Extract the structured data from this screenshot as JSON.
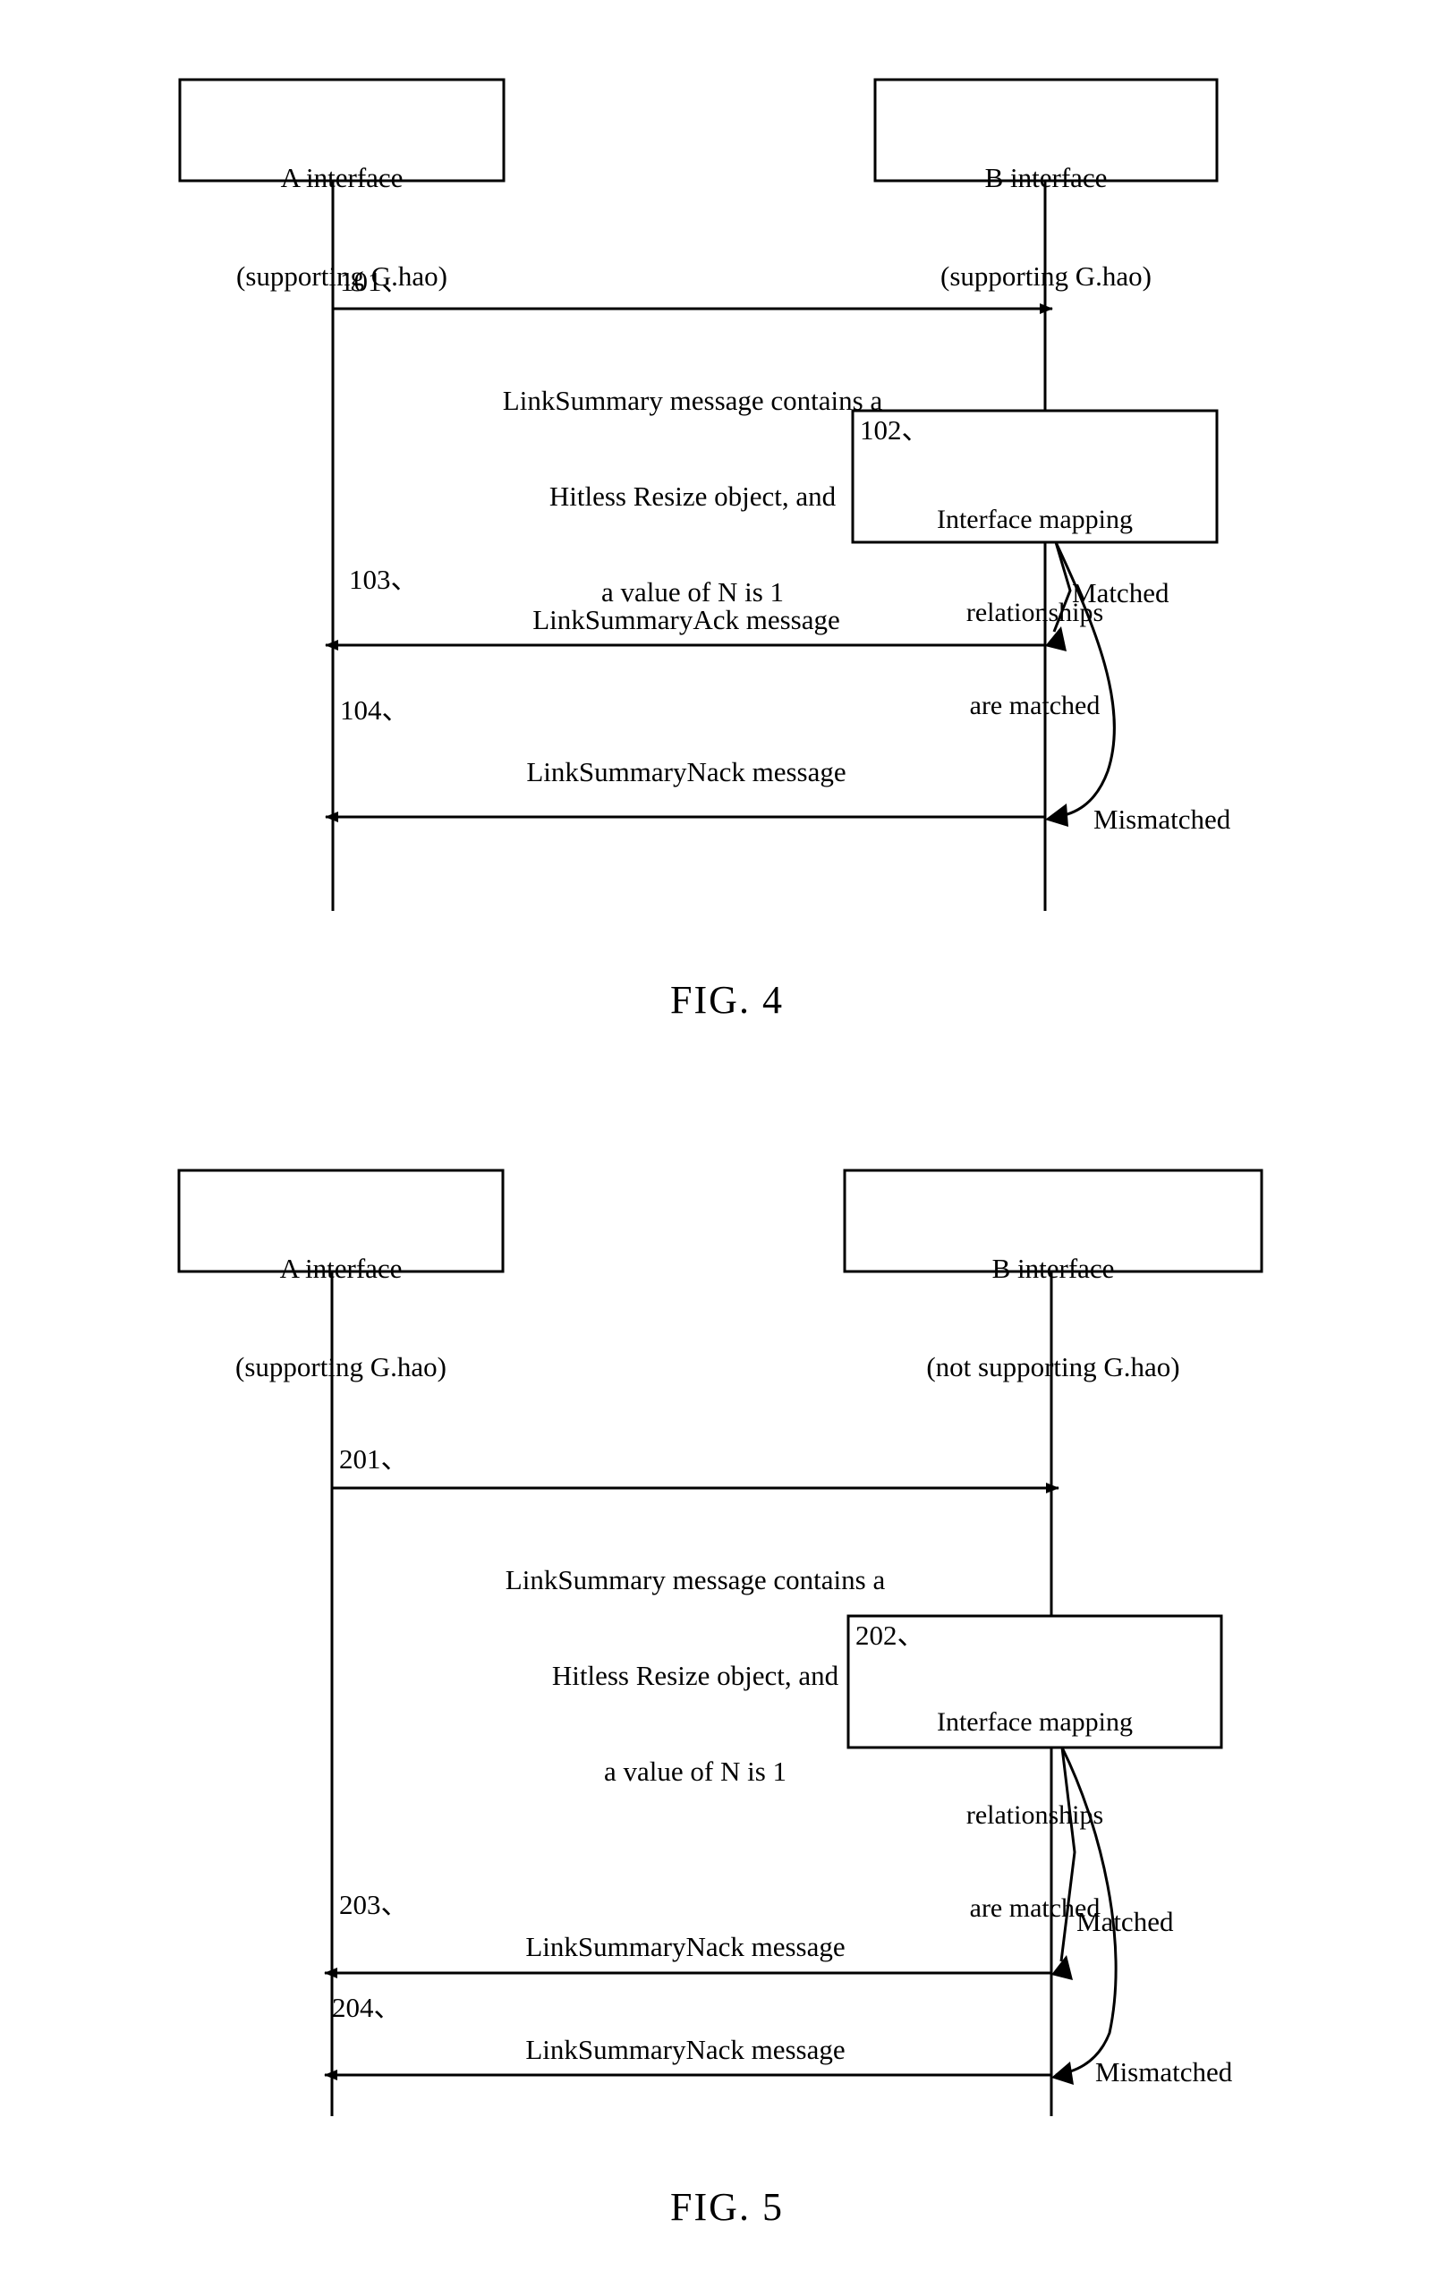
{
  "document": {
    "kind": "patent-figure-sheet",
    "figures": [
      {
        "id": "fig4",
        "caption": "FIG. 4",
        "actors": [
          {
            "id": "a",
            "line1": "A interface",
            "line2": "(supporting G.hao)"
          },
          {
            "id": "b",
            "line1": "B interface",
            "line2": "(supporting G.hao)"
          }
        ],
        "steps": [
          {
            "number": "101、",
            "direction": "a-to-b",
            "label_lines": [
              "LinkSummary message contains a",
              "Hitless Resize object, and",
              "a value of N is 1"
            ]
          },
          {
            "number": "102、",
            "kind": "note",
            "label_lines": [
              "Interface mapping",
              "relationships",
              "are matched"
            ]
          },
          {
            "number": "103、",
            "direction": "b-to-a",
            "label_lines": [
              "LinkSummaryAck message"
            ],
            "branch": "Matched"
          },
          {
            "number": "104、",
            "direction": "b-to-a",
            "label_lines": [
              "LinkSummaryNack message"
            ],
            "branch": "Mismatched"
          }
        ]
      },
      {
        "id": "fig5",
        "caption": "FIG. 5",
        "actors": [
          {
            "id": "a",
            "line1": "A interface",
            "line2": "(supporting G.hao)"
          },
          {
            "id": "b",
            "line1": "B interface",
            "line2": "(not supporting G.hao)"
          }
        ],
        "steps": [
          {
            "number": "201、",
            "direction": "a-to-b",
            "label_lines": [
              "LinkSummary message contains a",
              "Hitless Resize object, and",
              "a value of N is 1"
            ]
          },
          {
            "number": "202、",
            "kind": "note",
            "label_lines": [
              "Interface mapping",
              "relationships",
              "are matched"
            ]
          },
          {
            "number": "203、",
            "direction": "b-to-a",
            "label_lines": [
              "LinkSummaryNack message"
            ],
            "branch": "Matched"
          },
          {
            "number": "204、",
            "direction": "b-to-a",
            "label_lines": [
              "LinkSummaryNack message"
            ],
            "branch": "Mismatched"
          }
        ]
      }
    ]
  },
  "fig4": {
    "caption": "FIG. 4",
    "actor_a": {
      "line1": "A interface",
      "line2": "(supporting G.hao)"
    },
    "actor_b": {
      "line1": "B interface",
      "line2": "(supporting G.hao)"
    },
    "step101": {
      "number": "101、",
      "line1": "LinkSummary message contains a",
      "line2": "Hitless Resize object, and",
      "line3": "a value of N is 1"
    },
    "step102": {
      "number": "102、",
      "line1": "Interface mapping",
      "line2": "relationships",
      "line3": "are matched"
    },
    "step103": {
      "number": "103、",
      "message": "LinkSummaryAck message",
      "branch": "Matched"
    },
    "step104": {
      "number": "104、",
      "message": "LinkSummaryNack message",
      "branch": "Mismatched"
    }
  },
  "fig5": {
    "caption": "FIG. 5",
    "actor_a": {
      "line1": "A interface",
      "line2": "(supporting G.hao)"
    },
    "actor_b": {
      "line1": "B interface",
      "line2": "(not supporting G.hao)"
    },
    "step201": {
      "number": "201、",
      "line1": "LinkSummary message contains a",
      "line2": "Hitless Resize object, and",
      "line3": "a value of N is 1"
    },
    "step202": {
      "number": "202、",
      "line1": "Interface mapping",
      "line2": "relationships",
      "line3": "are matched"
    },
    "step203": {
      "number": "203、",
      "message": "LinkSummaryNack message",
      "branch": "Matched"
    },
    "step204": {
      "number": "204、",
      "message": "LinkSummaryNack message",
      "branch": "Mismatched"
    }
  },
  "style": {
    "ink": "#000000",
    "paper": "#ffffff"
  }
}
